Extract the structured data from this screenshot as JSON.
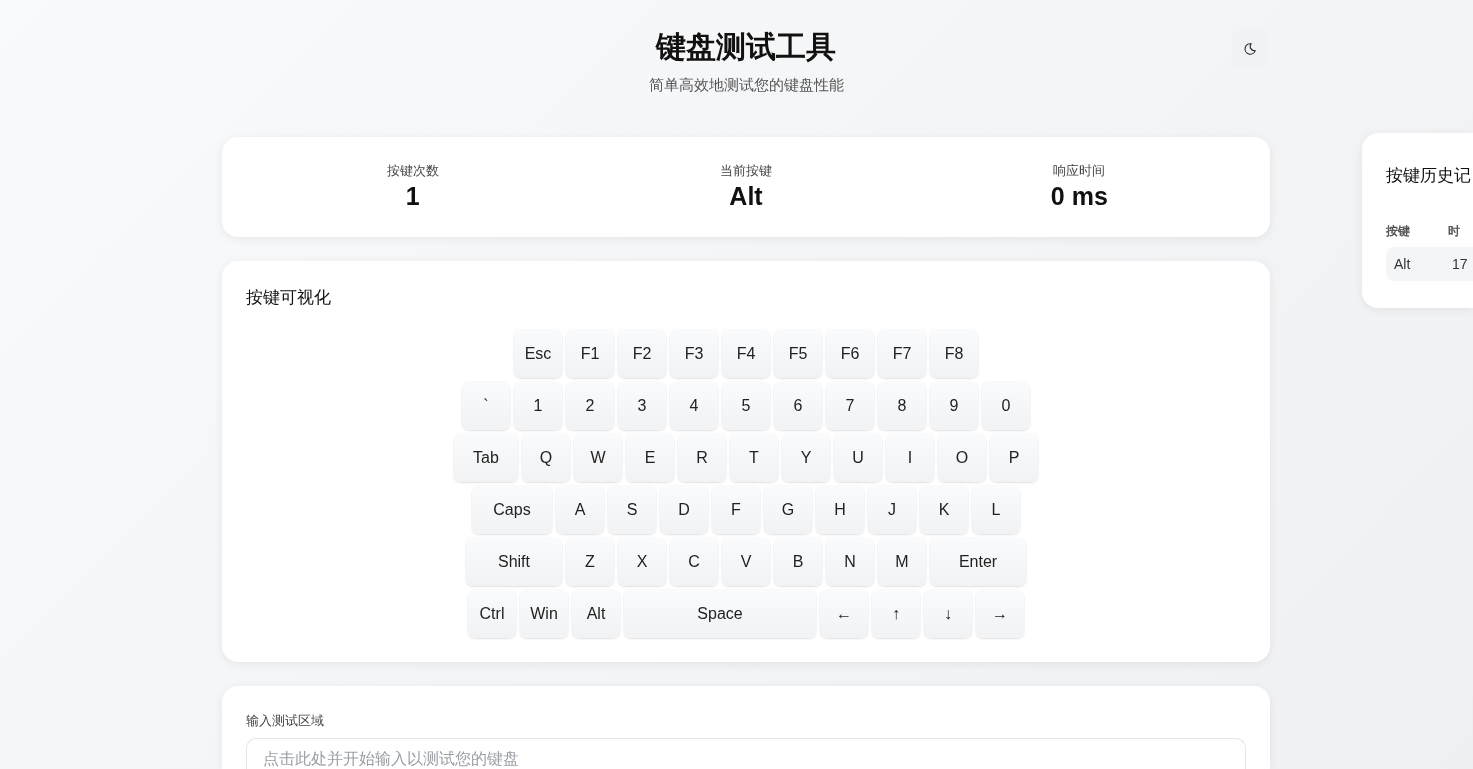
{
  "header": {
    "title": "键盘测试工具",
    "subtitle": "简单高效地测试您的键盘性能"
  },
  "stats": [
    {
      "label": "按键次数",
      "value": "1"
    },
    {
      "label": "当前按键",
      "value": "Alt"
    },
    {
      "label": "响应时间",
      "value": "0 ms"
    }
  ],
  "keyboard": {
    "title": "按键可视化",
    "rows": [
      [
        {
          "label": "Esc",
          "kind": "normal"
        },
        {
          "label": "F1",
          "kind": "normal"
        },
        {
          "label": "F2",
          "kind": "normal"
        },
        {
          "label": "F3",
          "kind": "normal"
        },
        {
          "label": "F4",
          "kind": "normal"
        },
        {
          "label": "F5",
          "kind": "normal"
        },
        {
          "label": "F6",
          "kind": "normal"
        },
        {
          "label": "F7",
          "kind": "normal"
        },
        {
          "label": "F8",
          "kind": "normal"
        }
      ],
      [
        {
          "label": "`",
          "kind": "normal"
        },
        {
          "label": "1",
          "kind": "normal"
        },
        {
          "label": "2",
          "kind": "normal"
        },
        {
          "label": "3",
          "kind": "normal"
        },
        {
          "label": "4",
          "kind": "normal"
        },
        {
          "label": "5",
          "kind": "normal"
        },
        {
          "label": "6",
          "kind": "normal"
        },
        {
          "label": "7",
          "kind": "normal"
        },
        {
          "label": "8",
          "kind": "normal"
        },
        {
          "label": "9",
          "kind": "normal"
        },
        {
          "label": "0",
          "kind": "normal"
        }
      ],
      [
        {
          "label": "Tab",
          "kind": "tab"
        },
        {
          "label": "Q",
          "kind": "normal"
        },
        {
          "label": "W",
          "kind": "normal"
        },
        {
          "label": "E",
          "kind": "normal"
        },
        {
          "label": "R",
          "kind": "normal"
        },
        {
          "label": "T",
          "kind": "normal"
        },
        {
          "label": "Y",
          "kind": "normal"
        },
        {
          "label": "U",
          "kind": "normal"
        },
        {
          "label": "I",
          "kind": "normal"
        },
        {
          "label": "O",
          "kind": "normal"
        },
        {
          "label": "P",
          "kind": "normal"
        }
      ],
      [
        {
          "label": "Caps",
          "kind": "caps"
        },
        {
          "label": "A",
          "kind": "normal"
        },
        {
          "label": "S",
          "kind": "normal"
        },
        {
          "label": "D",
          "kind": "normal"
        },
        {
          "label": "F",
          "kind": "normal"
        },
        {
          "label": "G",
          "kind": "normal"
        },
        {
          "label": "H",
          "kind": "normal"
        },
        {
          "label": "J",
          "kind": "normal"
        },
        {
          "label": "K",
          "kind": "normal"
        },
        {
          "label": "L",
          "kind": "normal"
        }
      ],
      [
        {
          "label": "Shift",
          "kind": "shift"
        },
        {
          "label": "Z",
          "kind": "normal"
        },
        {
          "label": "X",
          "kind": "normal"
        },
        {
          "label": "C",
          "kind": "normal"
        },
        {
          "label": "V",
          "kind": "normal"
        },
        {
          "label": "B",
          "kind": "normal"
        },
        {
          "label": "N",
          "kind": "normal"
        },
        {
          "label": "M",
          "kind": "normal"
        },
        {
          "label": "Enter",
          "kind": "enter"
        }
      ],
      [
        {
          "label": "Ctrl",
          "kind": "normal"
        },
        {
          "label": "Win",
          "kind": "normal"
        },
        {
          "label": "Alt",
          "kind": "normal"
        },
        {
          "label": "Space",
          "kind": "space"
        },
        {
          "label": "←",
          "kind": "normal"
        },
        {
          "label": "↑",
          "kind": "normal"
        },
        {
          "label": "↓",
          "kind": "normal"
        },
        {
          "label": "→",
          "kind": "normal"
        }
      ]
    ]
  },
  "input_test": {
    "label": "输入测试区域",
    "placeholder": "点击此处并开始输入以测试您的键盘"
  },
  "history": {
    "title": "按键历史记",
    "columns": [
      "按键",
      "时"
    ],
    "rows": [
      [
        "Alt",
        "17"
      ]
    ]
  }
}
